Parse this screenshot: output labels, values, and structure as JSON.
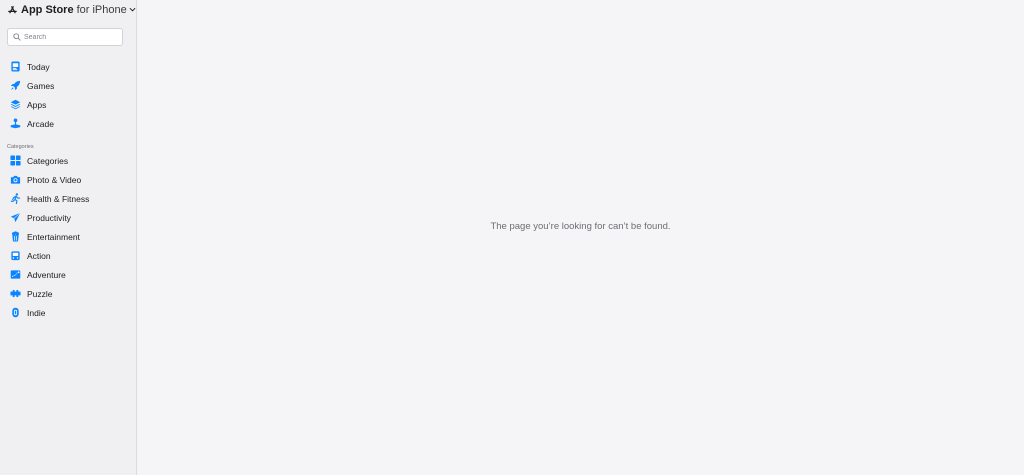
{
  "header": {
    "brand_bold": "App Store",
    "brand_suffix": "for iPhone"
  },
  "search": {
    "placeholder": "Search",
    "value": ""
  },
  "nav": {
    "main": [
      {
        "label": "Today",
        "icon": "today-icon"
      },
      {
        "label": "Games",
        "icon": "rocket-icon"
      },
      {
        "label": "Apps",
        "icon": "layers-icon"
      },
      {
        "label": "Arcade",
        "icon": "joystick-icon"
      }
    ],
    "section_label": "Categories",
    "categories": [
      {
        "label": "Categories",
        "icon": "grid-icon"
      },
      {
        "label": "Photo & Video",
        "icon": "camera-icon"
      },
      {
        "label": "Health & Fitness",
        "icon": "running-icon"
      },
      {
        "label": "Productivity",
        "icon": "paper-plane-icon"
      },
      {
        "label": "Entertainment",
        "icon": "popcorn-icon"
      },
      {
        "label": "Action",
        "icon": "gamepad-icon"
      },
      {
        "label": "Adventure",
        "icon": "map-icon"
      },
      {
        "label": "Puzzle",
        "icon": "puzzle-icon"
      },
      {
        "label": "Indie",
        "icon": "indie-icon"
      }
    ]
  },
  "main": {
    "message": "The page you’re looking for can’t be found."
  },
  "colors": {
    "accent": "#0a84ff",
    "sidebar_bg": "#f0f0f2",
    "main_bg": "#f5f5f7"
  }
}
